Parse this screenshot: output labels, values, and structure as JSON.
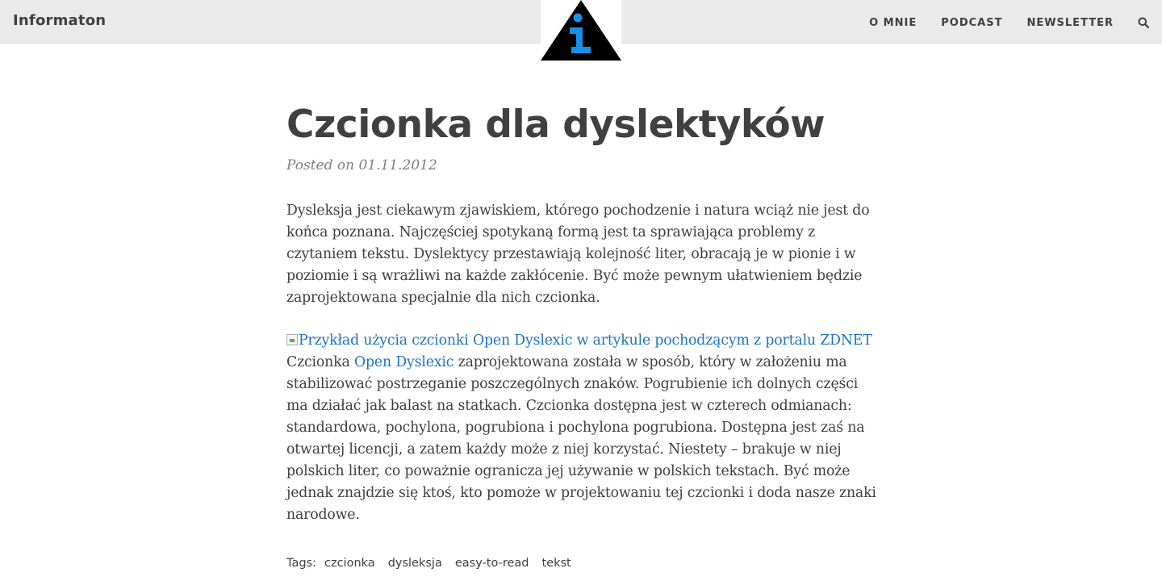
{
  "header": {
    "brand": "Informaton",
    "nav": [
      {
        "label": "O MNIE"
      },
      {
        "label": "PODCAST"
      },
      {
        "label": "NEWSLETTER"
      }
    ],
    "search_icon": "search-icon",
    "logo_icon": "info-triangle-logo-icon"
  },
  "post": {
    "title": "Czcionka dla dyslektyków",
    "meta": "Posted on 01.11.2012",
    "paragraph1": "Dysleksja jest ciekawym zjawiskiem, którego pochodzenie i natura wciąż nie jest do końca poznana. Najczęściej spotykaną formą jest ta sprawiająca problemy z czytaniem tekstu. Dyslektycy przestawiają kolejność liter, obracają je w pionie i w poziomie i są wrażliwi na każde zakłócenie. Być może pewnym ułatwieniem będzie zaprojektowana specjalnie dla nich czcionka.",
    "image_alt": "Przykład użycia czcionki Open Dyslexic w artykule pochodzącym z portalu ZDNET",
    "paragraph2_pre": "Czcionka ",
    "paragraph2_link": "Open Dyslexic",
    "paragraph2_post": " zaprojektowana została w sposób, który w założeniu ma stabilizować postrzeganie poszczególnych znaków. Pogrubienie ich dolnych części ma działać jak balast na statkach. Czcionka dostępna jest w czterech odmianach: standardowa, pochylona, pogrubiona i pochylona pogrubiona. Dostępna jest zaś na otwartej licencji, a zatem każdy może z niej korzystać. Niestety – brakuje w niej polskich liter, co poważnie ogranicza jej używanie w polskich tekstach. Być może jednak znajdzie się ktoś, kto pomoże w projektowaniu tej czcionki i doda nasze znaki narodowe."
  },
  "tags": {
    "label": "Tags:",
    "items": [
      "czcionka",
      "dysleksja",
      "easy-to-read",
      "tekst"
    ]
  },
  "colors": {
    "topbar": "#eaeaea",
    "text": "#404040",
    "link": "#1f73c2",
    "logo_blue": "#1a8fe8"
  }
}
